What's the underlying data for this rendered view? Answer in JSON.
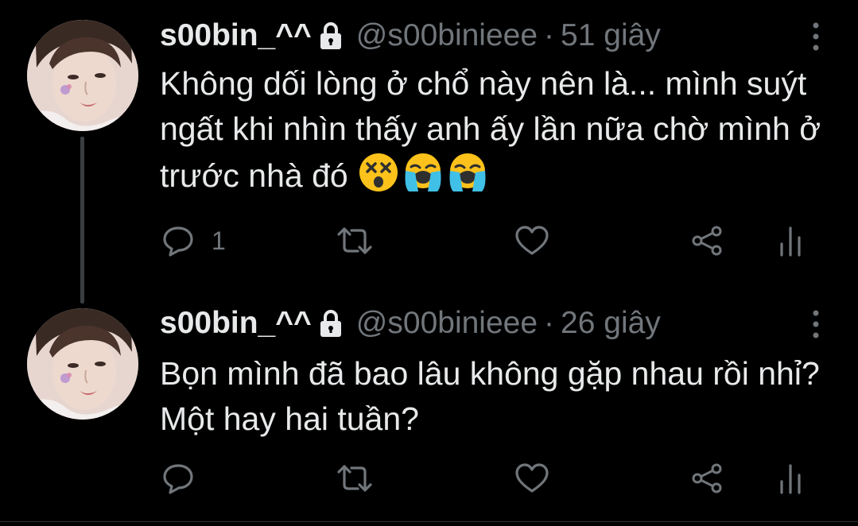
{
  "colors": {
    "background": "#000000",
    "text_primary": "#e7e9ea",
    "text_secondary": "#71767b",
    "thread_line": "#3a3d40"
  },
  "tweets": [
    {
      "display_name": "s00bin_^^",
      "handle": "@s00binieee",
      "separator": "·",
      "time": "51 giây",
      "text": "Không dối lòng ở chổ này nên là... mình suýt ngất khi nhìn thấy anh ấy lần nữa chờ mình ở trước nhà đó",
      "emojis": [
        "dizzy-face",
        "loudly-crying-face",
        "loudly-crying-face"
      ],
      "actions": {
        "reply_count": "1"
      }
    },
    {
      "display_name": "s00bin_^^",
      "handle": "@s00binieee",
      "separator": "·",
      "time": "26 giây",
      "text": "Bọn mình đã bao lâu không gặp nhau rồi nhỉ? Một hay hai tuần?",
      "emojis": [],
      "actions": {
        "reply_count": ""
      }
    }
  ]
}
